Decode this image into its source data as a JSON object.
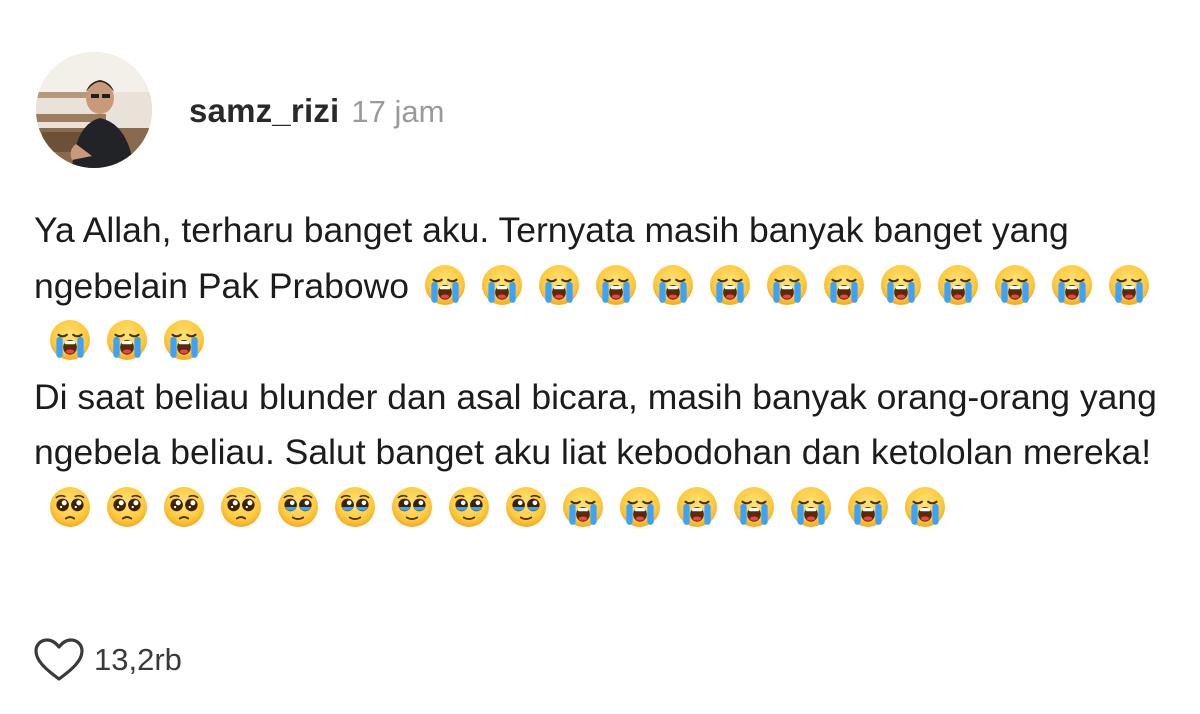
{
  "post": {
    "username": "samz_rizi",
    "time": "17 jam",
    "paragraph1": {
      "text": "Ya Allah, terharu banget aku. Ternyata masih banyak banget yang ngebelain Pak Prabowo",
      "emojis": [
        "loudly-crying-face",
        "loudly-crying-face",
        "loudly-crying-face",
        "loudly-crying-face",
        "loudly-crying-face",
        "loudly-crying-face",
        "loudly-crying-face",
        "loudly-crying-face",
        "loudly-crying-face",
        "loudly-crying-face",
        "loudly-crying-face",
        "loudly-crying-face",
        "loudly-crying-face",
        "loudly-crying-face",
        "loudly-crying-face",
        "loudly-crying-face"
      ]
    },
    "paragraph2": {
      "text": "Di saat beliau blunder dan asal bicara, masih banyak orang-orang yang ngebela beliau. Salut banget aku liat kebodohan dan ketololan mereka!",
      "emojis": [
        "pleading-face",
        "pleading-face",
        "pleading-face",
        "pleading-face",
        "face-holding-back-tears",
        "face-holding-back-tears",
        "face-holding-back-tears",
        "face-holding-back-tears",
        "face-holding-back-tears",
        "loudly-crying-face",
        "loudly-crying-face",
        "loudly-crying-face",
        "loudly-crying-face",
        "loudly-crying-face",
        "loudly-crying-face",
        "loudly-crying-face"
      ]
    },
    "likes": "13,2rb"
  },
  "colors": {
    "emoji_yellow": "#ffc83d",
    "tears_blue": "#3aa3ff",
    "username": "#2a2a2a",
    "time": "#9a9a9a"
  },
  "icons": {
    "like": "heart-outline-icon"
  }
}
